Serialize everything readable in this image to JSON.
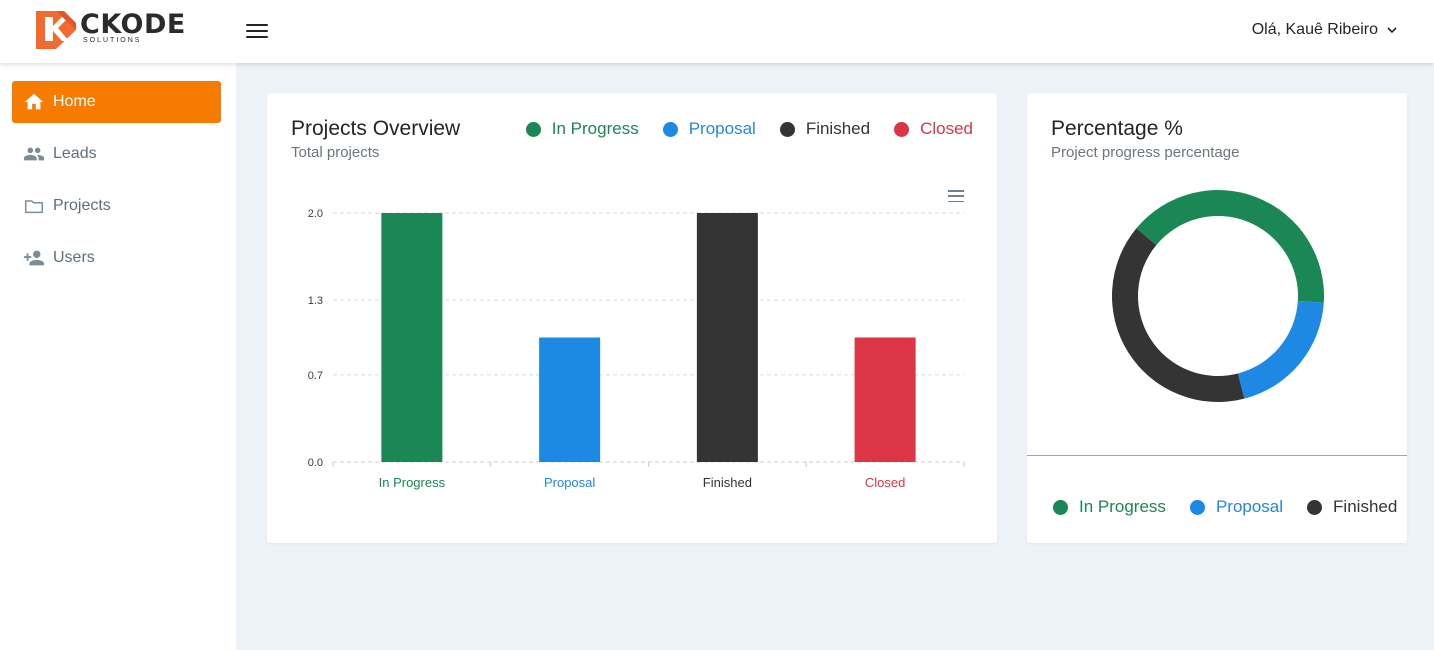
{
  "brand": {
    "name": "CKODE",
    "sub": "SOLUTIONS",
    "color": "#f26a2e"
  },
  "header": {
    "greeting": "Olá, Kauê Ribeiro"
  },
  "sidebar": {
    "items": [
      {
        "label": "Home",
        "icon": "home-icon",
        "active": true
      },
      {
        "label": "Leads",
        "icon": "people-icon",
        "active": false
      },
      {
        "label": "Projects",
        "icon": "folder-icon",
        "active": false
      },
      {
        "label": "Users",
        "icon": "add-user-icon",
        "active": false
      }
    ],
    "active_color": "#f57c00"
  },
  "overview": {
    "title": "Projects Overview",
    "subtitle": "Total projects",
    "legend": [
      {
        "label": "In Progress",
        "color": "#1a8754"
      },
      {
        "label": "Proposal",
        "color": "#1e88e5"
      },
      {
        "label": "Finished",
        "color": "#343434"
      },
      {
        "label": "Closed",
        "color": "#dc3545"
      }
    ]
  },
  "percentage": {
    "title": "Percentage %",
    "subtitle": "Project progress percentage",
    "legend": [
      {
        "label": "In Progress",
        "color": "#1a8754"
      },
      {
        "label": "Proposal",
        "color": "#1e88e5"
      },
      {
        "label": "Finished",
        "color": "#343434"
      }
    ]
  },
  "chart_data": [
    {
      "type": "bar",
      "categories": [
        "In Progress",
        "Proposal",
        "Finished",
        "Closed"
      ],
      "values": [
        2,
        1,
        2,
        1
      ],
      "colors": [
        "#1a8754",
        "#1e88e5",
        "#343434",
        "#dc3545"
      ],
      "y_ticks": [
        "0.0",
        "0.7",
        "1.3",
        "2.0"
      ],
      "ylim": [
        0,
        2
      ],
      "grid": true
    },
    {
      "type": "pie",
      "categories": [
        "In Progress",
        "Proposal",
        "Finished"
      ],
      "values": [
        2,
        1,
        2
      ],
      "colors": [
        "#1a8754",
        "#1e88e5",
        "#343434"
      ]
    }
  ]
}
